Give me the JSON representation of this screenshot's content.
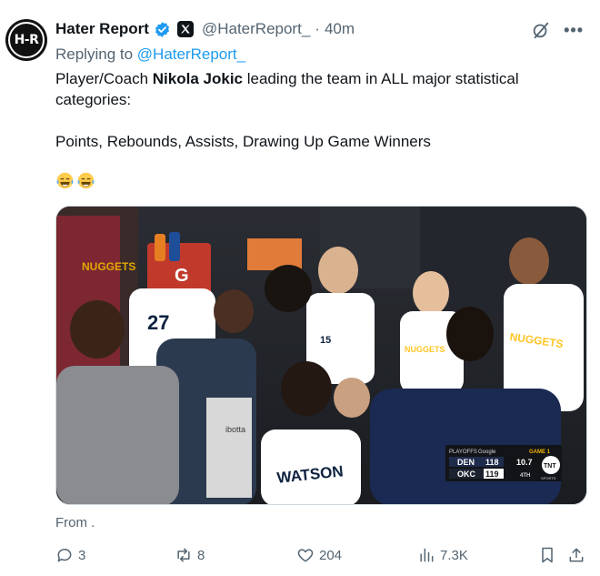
{
  "author": {
    "avatar_text": "H-R",
    "name": "Hater Report",
    "handle": "@HaterReport_",
    "separator": "·",
    "time": "40m"
  },
  "replying": {
    "prefix": "Replying to ",
    "handle": "@HaterReport_"
  },
  "tweet": {
    "line1_pre": "Player/Coach ",
    "line1_bold": "Nikola Jokic",
    "line1_post": " leading the team in ALL major statistical categories:",
    "line2": "Points, Rebounds, Assists, Drawing Up Game Winners",
    "emojis": [
      "face-with-tears-of-joy",
      "face-with-tears-of-joy"
    ]
  },
  "media": {
    "scorebug": {
      "brand": "PLAYOFFS",
      "sponsor": "Google",
      "game": "GAME 1",
      "team1": "DEN",
      "score1": "118",
      "team2": "OKC",
      "score2": "119",
      "clock": "10.7",
      "period": "4TH",
      "network": "TNT",
      "network_sub": "SPORTS"
    },
    "jersey_texts": [
      "NUGGETS",
      "WATSON",
      "NUGGETS",
      "ibotta"
    ]
  },
  "from_label": "From .",
  "actions": {
    "replies": "3",
    "reposts": "8",
    "likes": "204",
    "views": "7.3K"
  },
  "colors": {
    "accent": "#1d9bf0",
    "secondary_text": "#536471",
    "primary_text": "#0f1419"
  }
}
